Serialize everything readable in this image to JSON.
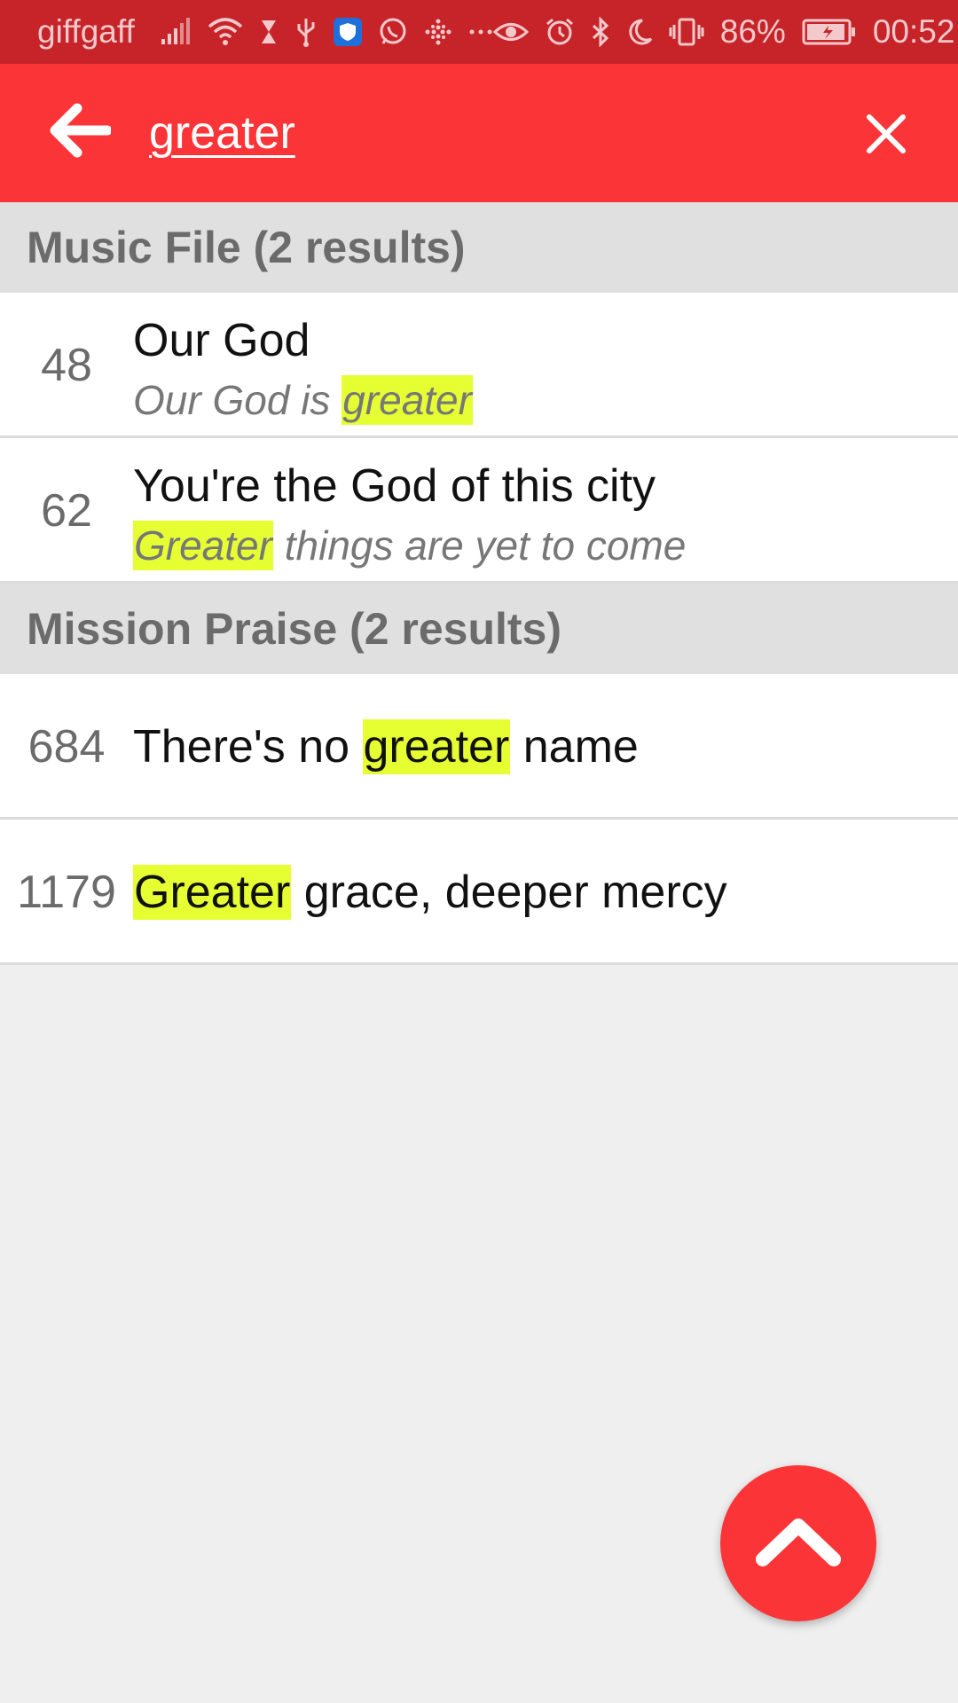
{
  "status_bar": {
    "carrier": "giffgaff",
    "battery": "86%",
    "time": "00:52",
    "icons_left": [
      "signal-icon",
      "wifi-icon",
      "hourglass-icon",
      "usb-icon",
      "shield-icon",
      "whatsapp-icon",
      "grid-dots-icon",
      "more-icon"
    ],
    "icons_right": [
      "eye-icon",
      "alarm-icon",
      "bluetooth-icon",
      "moon-icon",
      "vibrate-icon",
      "battery-icon"
    ]
  },
  "app_bar": {
    "search_value": "greater",
    "back_icon": "arrow-left-icon",
    "clear_icon": "close-icon"
  },
  "sections": [
    {
      "title": "Music File (2 results)",
      "results": [
        {
          "number": "48",
          "title": "Our God",
          "snippet_before": "Our God is ",
          "snippet_highlight": "greater",
          "snippet_after": ""
        },
        {
          "number": "62",
          "title": "You're the God of this city",
          "snippet_before": "",
          "snippet_highlight": "Greater",
          "snippet_after": " things are yet to come"
        }
      ]
    },
    {
      "title": "Mission Praise (2 results)",
      "results": [
        {
          "number": "684",
          "title_before": "There's no ",
          "title_highlight": "greater",
          "title_after": " name"
        },
        {
          "number": "1179",
          "title_before": "",
          "title_highlight": "Greater",
          "title_after": " grace, deeper mercy"
        }
      ]
    }
  ],
  "fab": {
    "icon": "chevron-up-icon"
  },
  "colors": {
    "accent": "#fb3437",
    "status_bar": "#c7242a",
    "highlight": "#e6ff33",
    "section_bg": "#e0e0e0",
    "page_bg": "#efefef"
  }
}
